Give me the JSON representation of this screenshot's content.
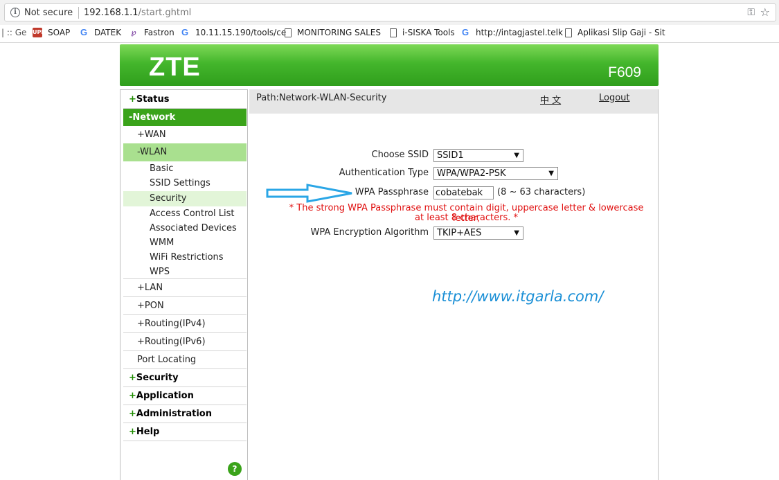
{
  "browser": {
    "security_label": "Not secure",
    "url_host": "192.168.1.1",
    "url_path": "/start.ghtml",
    "bookmarks": [
      {
        "icon": "folder-icon",
        "label": "| :: Ge"
      },
      {
        "icon": "upi-icon",
        "label": "SOAP"
      },
      {
        "icon": "google-icon",
        "label": "DATEK"
      },
      {
        "icon": "fastron-icon",
        "label": "Fastron"
      },
      {
        "icon": "google-icon",
        "label": "10.11.15.190/tools/ce"
      },
      {
        "icon": "page-icon",
        "label": "MONITORING SALES"
      },
      {
        "icon": "page-icon",
        "label": "i-SISKA Tools"
      },
      {
        "icon": "google-icon",
        "label": "http://intagjastel.telk"
      },
      {
        "icon": "page-icon",
        "label": "Aplikasi Slip Gaji - Sit"
      }
    ]
  },
  "header": {
    "logo": "ZTE",
    "model": "F609"
  },
  "sidebar": {
    "status": "Status",
    "network": "-Network",
    "wan": "+WAN",
    "wlan": "-WLAN",
    "wlan_items": [
      "Basic",
      "SSID Settings",
      "Security",
      "Access Control List",
      "Associated Devices",
      "WMM",
      "WiFi Restrictions",
      "WPS"
    ],
    "lan": "+LAN",
    "pon": "+PON",
    "routing4": "+Routing(IPv4)",
    "routing6": "+Routing(IPv6)",
    "port_locating": "Port Locating",
    "security": "Security",
    "application": "Application",
    "administration": "Administration",
    "help": "Help",
    "help_icon": "?"
  },
  "content": {
    "path": "Path:Network-WLAN-Security",
    "lang": "中 文",
    "logout": "Logout",
    "choose_ssid_label": "Choose SSID",
    "choose_ssid_value": "SSID1",
    "auth_type_label": "Authentication Type",
    "auth_type_value": "WPA/WPA2-PSK",
    "passphrase_label": "WPA Passphrase",
    "passphrase_value": "cobatebak",
    "passphrase_hint": "(8 ~ 63 characters)",
    "warning_line1": "* The strong WPA Passphrase must contain digit, uppercase letter & lowercase letter,",
    "warning_line2": "at least 8 characters. *",
    "encryption_label": "WPA Encryption Algorithm",
    "encryption_value": "TKIP+AES",
    "watermark": "http://www.itgarla.com/"
  },
  "colors": {
    "brand_green": "#3aa31a",
    "warning_red": "#e01010",
    "watermark_blue": "#1a8fd6",
    "arrow_blue": "#2aa6e6"
  }
}
